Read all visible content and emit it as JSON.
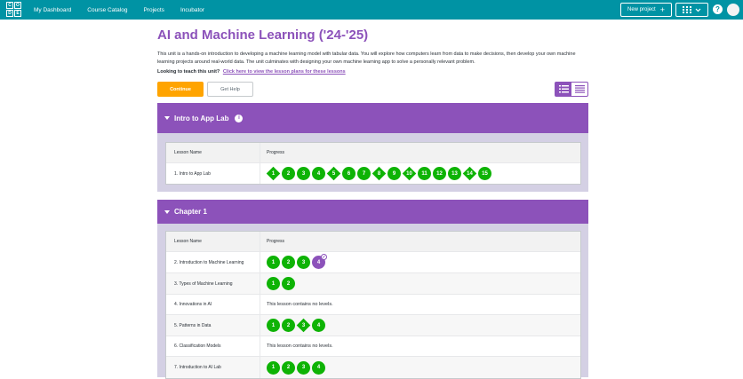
{
  "header": {
    "logo_letters": [
      "C",
      "O",
      "D",
      "E"
    ],
    "nav": [
      "My Dashboard",
      "Course Catalog",
      "Projects",
      "Incubator"
    ],
    "new_project": "New project",
    "new_project_icon": "+",
    "help_icon": "?"
  },
  "unit": {
    "title": "AI and Machine Learning ('24-'25)",
    "description": "This unit is a hands-on introduction to developing a machine learning model with tabular data. You will explore how computers learn from data to make decisions, then develop your own machine learning projects around real-world data. The unit culminates with designing your own machine learning app to solve a personally relevant problem.",
    "teach_prompt": "Looking to teach this unit?",
    "teach_link": "Click here to view the lesson plans for these lessons",
    "continue_label": "Continue",
    "get_help_label": "Get Help"
  },
  "colors": {
    "brand": "#0093a4",
    "accent": "#8c52ba",
    "continue": "#ffa400",
    "complete": "#0eb305"
  },
  "table_headers": {
    "name": "Lesson Name",
    "progress": "Progress"
  },
  "sections": [
    {
      "title": "Intro to App Lab",
      "info_icon": "i",
      "lessons": [
        {
          "name": "1. Intro to App Lab",
          "levels": [
            {
              "label": "1",
              "shape": "diamond"
            },
            {
              "label": "2",
              "shape": "circle"
            },
            {
              "label": "3",
              "shape": "circle"
            },
            {
              "label": "4",
              "shape": "circle"
            },
            {
              "label": "5",
              "shape": "diamond"
            },
            {
              "label": "6",
              "shape": "circle"
            },
            {
              "label": "7",
              "shape": "circle"
            },
            {
              "label": "8",
              "shape": "diamond"
            },
            {
              "label": "9",
              "shape": "circle"
            },
            {
              "label": "10",
              "shape": "diamond"
            },
            {
              "label": "11",
              "shape": "circle"
            },
            {
              "label": "12",
              "shape": "circle"
            },
            {
              "label": "13",
              "shape": "circle"
            },
            {
              "label": "14",
              "shape": "diamond"
            },
            {
              "label": "15",
              "shape": "circle"
            }
          ]
        }
      ]
    },
    {
      "title": "Chapter 1",
      "lessons": [
        {
          "name": "2. Introduction to Machine Learning",
          "levels": [
            {
              "label": "1",
              "shape": "circle"
            },
            {
              "label": "2",
              "shape": "circle"
            },
            {
              "label": "3",
              "shape": "circle"
            },
            {
              "label": "4",
              "shape": "circle",
              "state": "in-progress"
            }
          ]
        },
        {
          "name": "3. Types of Machine Learning",
          "levels": [
            {
              "label": "1",
              "shape": "circle"
            },
            {
              "label": "2",
              "shape": "circle"
            }
          ]
        },
        {
          "name": "4. Innovations in AI",
          "note": "This lesson contains no levels."
        },
        {
          "name": "5. Patterns in Data",
          "levels": [
            {
              "label": "1",
              "shape": "circle"
            },
            {
              "label": "2",
              "shape": "circle"
            },
            {
              "label": "3",
              "shape": "diamond"
            },
            {
              "label": "4",
              "shape": "circle"
            }
          ]
        },
        {
          "name": "6. Classification Models",
          "note": "This lesson contains no levels."
        },
        {
          "name": "7. Introduction to AI Lab",
          "levels": [
            {
              "label": "1",
              "shape": "circle"
            },
            {
              "label": "2",
              "shape": "circle"
            },
            {
              "label": "3",
              "shape": "circle"
            },
            {
              "label": "4",
              "shape": "circle"
            }
          ]
        }
      ]
    }
  ]
}
